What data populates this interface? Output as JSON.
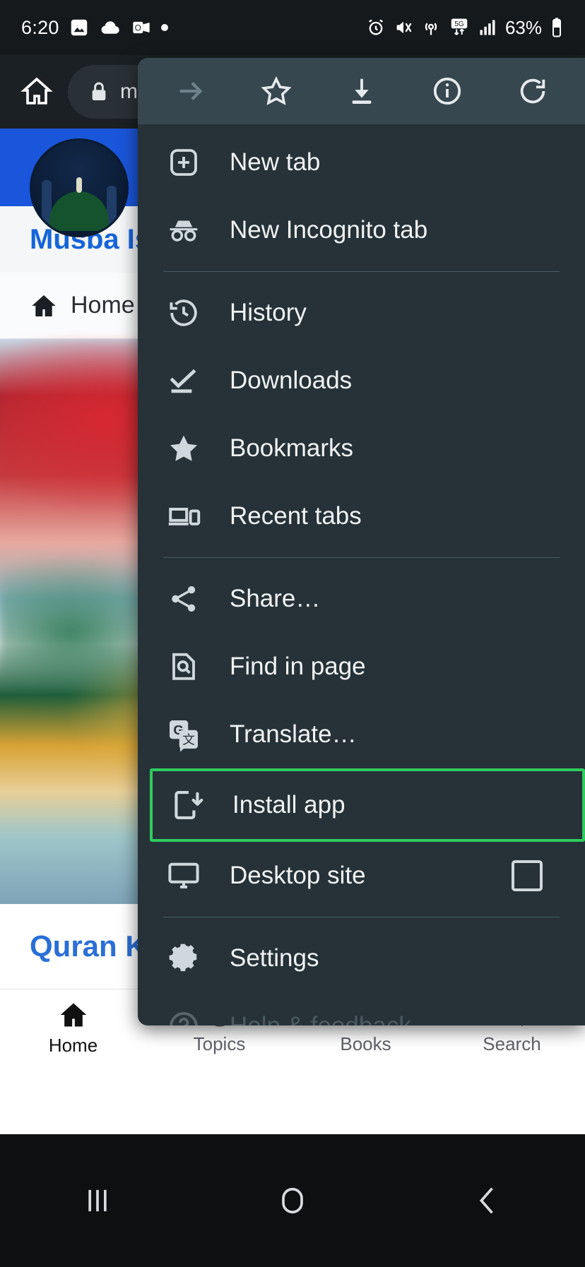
{
  "status_bar": {
    "time": "6:20",
    "left_icons": [
      "photo-icon",
      "cloud-icon",
      "outlook-icon",
      "dot-icon"
    ],
    "right_icons": [
      "alarm-icon",
      "mute-vibrate-icon",
      "hotspot-icon",
      "5g-icon",
      "signal-bars-icon"
    ],
    "battery_text": "63%"
  },
  "browser_toolbar": {
    "home_icon": "home-icon",
    "lock_icon": "lock-icon",
    "url_text": "m"
  },
  "menu": {
    "top_actions": [
      {
        "name": "forward-icon",
        "label": "Forward",
        "enabled": false
      },
      {
        "name": "star-icon",
        "label": "Bookmark",
        "enabled": true
      },
      {
        "name": "download-icon",
        "label": "Download",
        "enabled": true
      },
      {
        "name": "page-info-icon",
        "label": "Page info",
        "enabled": true
      },
      {
        "name": "reload-icon",
        "label": "Reload",
        "enabled": true
      }
    ],
    "items": [
      {
        "label": "New tab",
        "icon": "new-tab-icon",
        "highlighted": false
      },
      {
        "label": "New Incognito tab",
        "icon": "incognito-icon",
        "highlighted": false
      },
      {
        "label": "History",
        "icon": "history-icon",
        "highlighted": false
      },
      {
        "label": "Downloads",
        "icon": "downloads-icon",
        "highlighted": false
      },
      {
        "label": "Bookmarks",
        "icon": "bookmarks-star-icon",
        "highlighted": false
      },
      {
        "label": "Recent tabs",
        "icon": "recent-tabs-icon",
        "highlighted": false
      },
      {
        "label": "Share…",
        "icon": "share-icon",
        "highlighted": false
      },
      {
        "label": "Find in page",
        "icon": "find-in-page-icon",
        "highlighted": false
      },
      {
        "label": "Translate…",
        "icon": "translate-icon",
        "highlighted": false
      },
      {
        "label": "Install app",
        "icon": "install-app-icon",
        "highlighted": true
      },
      {
        "label": "Desktop site",
        "icon": "desktop-site-icon",
        "highlighted": false,
        "checkbox": false
      },
      {
        "label": "Settings",
        "icon": "settings-gear-icon",
        "highlighted": false
      },
      {
        "label": "Help & feedback",
        "icon": "help-icon",
        "highlighted": false
      }
    ],
    "highlight_color": "#2ecc5f"
  },
  "page": {
    "site_title": "Musba Isla",
    "nav_home_label": "Home",
    "caption": "Quran Kar",
    "tabs": [
      {
        "label": "Home",
        "icon": "home-filled-icon",
        "active": true
      },
      {
        "label": "Topics",
        "icon": "topics-icon",
        "active": false
      },
      {
        "label": "Books",
        "icon": "books-icon",
        "active": false
      },
      {
        "label": "Search",
        "icon": "search-icon",
        "active": false
      }
    ]
  },
  "android_nav": {
    "recents_label": "recent-apps-icon",
    "home_label": "home-circle-icon",
    "back_label": "back-chevron-icon"
  }
}
